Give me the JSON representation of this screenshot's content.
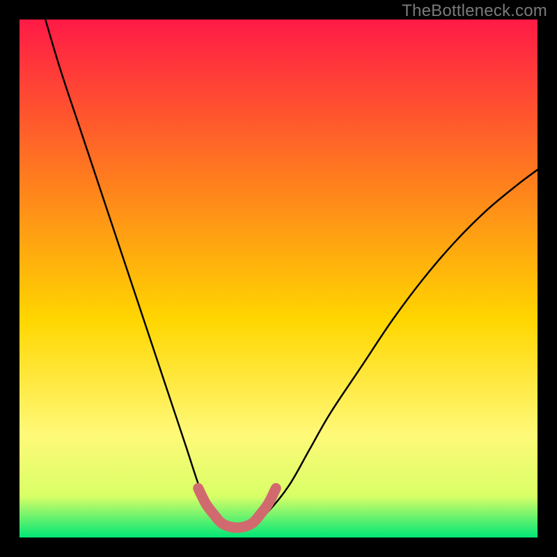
{
  "watermark": "TheBottleneck.com",
  "colors": {
    "frame": "#000000",
    "grad_top": "#ff1a46",
    "grad_mid_upper": "#ff7a1f",
    "grad_mid": "#ffd600",
    "grad_mid_lower": "#fff978",
    "grad_lower": "#d9ff66",
    "grad_bottom": "#00e676",
    "curve": "#000000",
    "highlight": "#d16a6f"
  },
  "chart_data": {
    "type": "line",
    "title": "",
    "xlabel": "",
    "ylabel": "",
    "xlim": [
      0,
      100
    ],
    "ylim": [
      0,
      100
    ],
    "series": [
      {
        "name": "bottleneck-curve",
        "x": [
          5,
          8,
          12,
          16,
          20,
          24,
          28,
          32,
          35,
          37,
          39,
          41,
          43,
          45,
          48,
          52,
          56,
          60,
          66,
          72,
          78,
          84,
          90,
          96,
          100
        ],
        "y": [
          100,
          90,
          78,
          66,
          54,
          42,
          30,
          18,
          9,
          5,
          2.5,
          2,
          2,
          2.5,
          5,
          10,
          17,
          24,
          33,
          42,
          50,
          57,
          63,
          68,
          71
        ]
      },
      {
        "name": "highlight-segment",
        "x": [
          34.5,
          36,
          37.5,
          39,
          41,
          43,
          45,
          46.5,
          48,
          49.5
        ],
        "y": [
          9.5,
          6.5,
          4.5,
          2.8,
          2,
          2,
          2.8,
          4.5,
          6.5,
          9.5
        ]
      }
    ]
  }
}
